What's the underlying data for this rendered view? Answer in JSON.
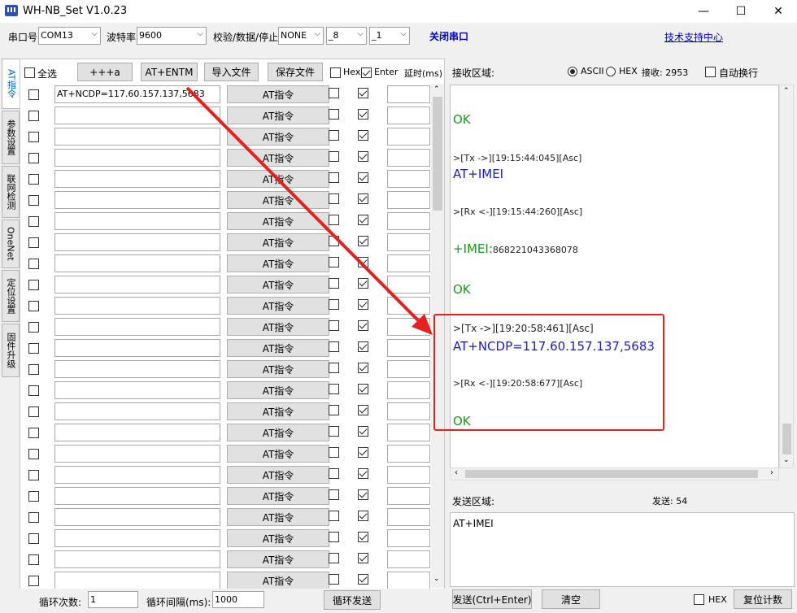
{
  "window": {
    "title": "WH-NB_Set V1.0.23",
    "minimize": "—",
    "maximize": "☐",
    "close": "✕"
  },
  "topbar": {
    "port_label": "串口号",
    "port_value": "COM13",
    "baud_label": "波特率",
    "baud_value": "9600",
    "parity_label": "校验/数据/停止",
    "parity_value": "NONE",
    "databits_value": "_8",
    "stopbits_value": "_1",
    "close_port": "关闭串口",
    "support_link": "技术支持中心"
  },
  "tabs": [
    "AT指令",
    "参数设置",
    "联网检测",
    "OneNet",
    "定位设置",
    "固件升级"
  ],
  "toolbar": {
    "select_all": "全选",
    "plus3a": "+++a",
    "at_entm": "AT+ENTM",
    "import_file": "导入文件",
    "save_file": "保存文件",
    "hex": "Hex",
    "enter": "Enter",
    "delay": "延时(ms)"
  },
  "command_rows": [
    {
      "cmd": "AT+NCDP=117.60.157.137,5683",
      "button": "AT指令"
    },
    {
      "cmd": "",
      "button": "AT指令"
    },
    {
      "cmd": "",
      "button": "AT指令"
    },
    {
      "cmd": "",
      "button": "AT指令"
    },
    {
      "cmd": "",
      "button": "AT指令"
    },
    {
      "cmd": "",
      "button": "AT指令"
    },
    {
      "cmd": "",
      "button": "AT指令"
    },
    {
      "cmd": "",
      "button": "AT指令"
    },
    {
      "cmd": "",
      "button": "AT指令"
    },
    {
      "cmd": "",
      "button": "AT指令"
    },
    {
      "cmd": "",
      "button": "AT指令"
    },
    {
      "cmd": "",
      "button": "AT指令"
    },
    {
      "cmd": "",
      "button": "AT指令"
    },
    {
      "cmd": "",
      "button": "AT指令"
    },
    {
      "cmd": "",
      "button": "AT指令"
    },
    {
      "cmd": "",
      "button": "AT指令"
    },
    {
      "cmd": "",
      "button": "AT指令"
    },
    {
      "cmd": "",
      "button": "AT指令"
    },
    {
      "cmd": "",
      "button": "AT指令"
    },
    {
      "cmd": "",
      "button": "AT指令"
    },
    {
      "cmd": "",
      "button": "AT指令"
    },
    {
      "cmd": "",
      "button": "AT指令"
    },
    {
      "cmd": "",
      "button": "AT指令"
    },
    {
      "cmd": "",
      "button": "AT指令"
    },
    {
      "cmd": "",
      "button": "AT指令"
    },
    {
      "cmd": "",
      "button": "AT指令"
    }
  ],
  "loop": {
    "count_label": "循环次数:",
    "count_value": "1",
    "interval_label": "循环间隔(ms):",
    "interval_value": "1000",
    "loop_send": "循环发送"
  },
  "receive": {
    "label": "接收区域:",
    "ascii": "ASCII",
    "hex": "HEX",
    "count_label": "接收: 2953",
    "auto_wrap": "自动换行",
    "lines": [
      {
        "text": "OK",
        "kind": "ok"
      },
      {
        "text": ">[Tx ->][19:15:44:045][Asc]",
        "kind": "meta"
      },
      {
        "text": "AT+IMEI",
        "kind": "cmd"
      },
      {
        "text": ">[Rx <-][19:15:44:260][Asc]",
        "kind": "meta"
      },
      {
        "text": "+IMEI:",
        "kind": "ok",
        "suffix": "868221043368078"
      },
      {
        "text": "OK",
        "kind": "ok"
      },
      {
        "text": ">[Tx ->][19:20:58:461][Asc]",
        "kind": "meta"
      },
      {
        "text": "AT+NCDP=117.60.157.137,5683",
        "kind": "cmd"
      },
      {
        "text": ">[Rx <-][19:20:58:677][Asc]",
        "kind": "meta"
      },
      {
        "text": "OK",
        "kind": "ok"
      }
    ]
  },
  "send": {
    "label": "发送区域:",
    "count_label": "发送: 54",
    "text": "AT+IMEI",
    "send_button": "发送(Ctrl+Enter)",
    "clear_button": "清空",
    "hex": "HEX",
    "reset_button": "复位计数"
  },
  "colors": {
    "highlight": "#e52020",
    "ok": "#1a9a1a",
    "cmd": "#1a1ac8",
    "link": "#0000cc"
  }
}
